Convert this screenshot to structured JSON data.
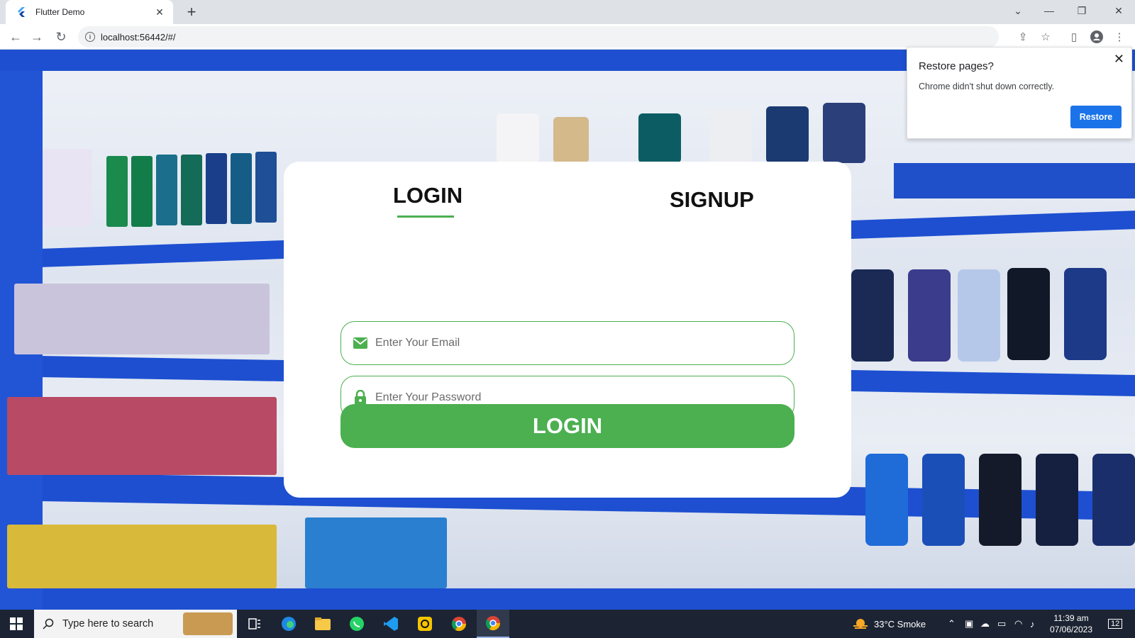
{
  "browser": {
    "tab_title": "Flutter Demo",
    "url": "localhost:56442/#/"
  },
  "app": {
    "tabs": {
      "login": "LOGIN",
      "signup": "SIGNUP"
    },
    "email_placeholder": "Enter Your Email",
    "password_placeholder": "Enter Your Password",
    "login_button": "LOGIN",
    "accent_color": "#4caf50"
  },
  "restore_popup": {
    "title": "Restore pages?",
    "message": "Chrome didn't shut down correctly.",
    "button": "Restore"
  },
  "taskbar": {
    "search_placeholder": "Type here to search",
    "weather": "33°C  Smoke",
    "time": "11:39 am",
    "date": "07/06/2023",
    "notifications": "12"
  }
}
